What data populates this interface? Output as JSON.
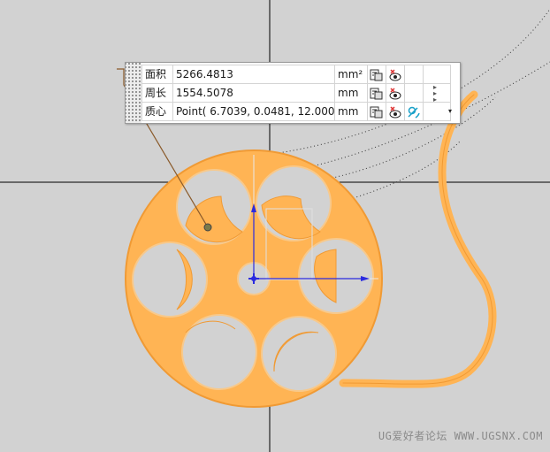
{
  "measurement_panel": {
    "rows": [
      {
        "label": "面积",
        "value": "5266.4813",
        "unit": "mm²"
      },
      {
        "label": "周长",
        "value": "1554.5078",
        "unit": "mm"
      },
      {
        "label": "质心",
        "value": "Point( 6.7039, 0.0481, 12.0000)",
        "unit": "mm"
      }
    ],
    "icons": {
      "export": "export-to-clipboard-icon",
      "show": "show-hide-icon",
      "associate": "associativity-icon"
    },
    "more_glyph": "▸",
    "dropdown_glyph": "▾"
  },
  "watermark": "UG爱好者论坛 WWW.UGSNX.COM",
  "colors": {
    "background": "#d2d2d2",
    "part_fill": "#ffb454",
    "part_edge": "#f09a34",
    "axis_blue": "#2a2ae0",
    "crosshair": "#000000"
  }
}
